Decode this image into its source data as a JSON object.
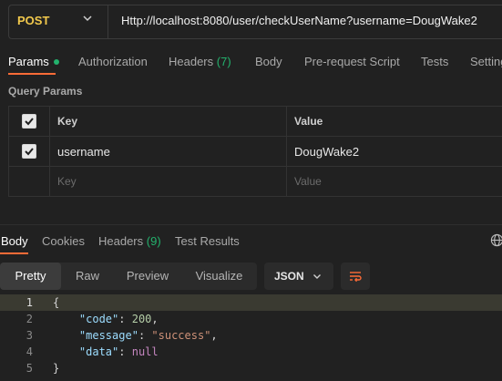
{
  "request": {
    "method": "POST",
    "url": "Http://localhost:8080/user/checkUserName?username=DougWake2"
  },
  "request_tabs": {
    "params": "Params",
    "authorization": "Authorization",
    "headers": "Headers",
    "headers_count": "(7)",
    "body": "Body",
    "pre_request": "Pre-request Script",
    "tests": "Tests",
    "settings": "Settings"
  },
  "query_params": {
    "title": "Query Params",
    "col_key": "Key",
    "col_value": "Value",
    "rows": [
      {
        "key": "username",
        "value": "DougWake2",
        "checked": true
      }
    ],
    "key_placeholder": "Key",
    "value_placeholder": "Value"
  },
  "response_tabs": {
    "body": "Body",
    "cookies": "Cookies",
    "headers": "Headers",
    "headers_count": "(9)",
    "test_results": "Test Results"
  },
  "response_view": {
    "pretty": "Pretty",
    "raw": "Raw",
    "preview": "Preview",
    "visualize": "Visualize",
    "format": "JSON"
  },
  "response_body": {
    "line_numbers": [
      "1",
      "2",
      "3",
      "4",
      "5"
    ],
    "open_brace": "{",
    "close_brace": "}",
    "fields": [
      {
        "key": "\"code\"",
        "value": "200",
        "comma": ","
      },
      {
        "key": "\"message\"",
        "value": "\"success\"",
        "comma": ","
      },
      {
        "key": "\"data\"",
        "value": "null",
        "comma": ""
      }
    ]
  },
  "colors": {
    "method": "#f2c94c",
    "accent": "#ff6c37",
    "count_green": "#23b26d"
  }
}
